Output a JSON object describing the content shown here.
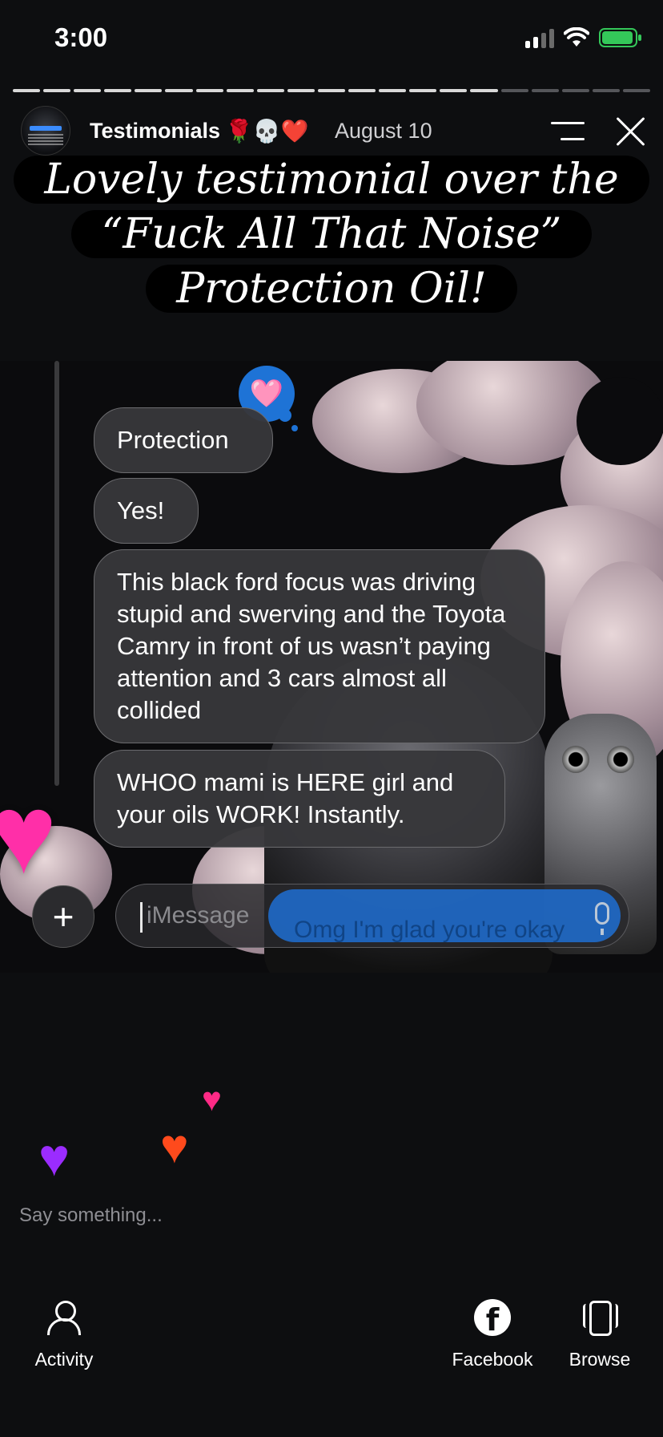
{
  "status_bar": {
    "time": "3:00"
  },
  "story": {
    "segments_total": 21,
    "segments_viewed": 16,
    "account_name": "Testimonials",
    "account_emojis": "🌹💀❤️",
    "date": "August 10",
    "caption_lines": [
      "Lovely testimonial over the",
      "“Fuck All That Noise”",
      "Protection Oil!"
    ]
  },
  "chat": {
    "tapback_emoji": "🩷",
    "messages": [
      "Protection",
      "Yes!",
      "This black ford focus was driving stupid and swerving and the Toyota Camry in front of us wasn’t paying attention and 3 cars almost all collided",
      "WHOO mami is HERE girl and your oils WORK! Instantly."
    ],
    "input_placeholder": "iMessage",
    "ghost_text": "Omg I'm glad you're okay",
    "plus_symbol": "+"
  },
  "reactions": {
    "big_heart": "♥",
    "floating": [
      "♥",
      "♥",
      "♥"
    ],
    "colors": [
      "#ff2a86",
      "#ff4a1c",
      "#9b2cff"
    ]
  },
  "reply": {
    "placeholder": "Say something..."
  },
  "bottom_nav": {
    "activity": "Activity",
    "facebook": "Facebook",
    "browse": "Browse",
    "facebook_glyph": "f"
  }
}
